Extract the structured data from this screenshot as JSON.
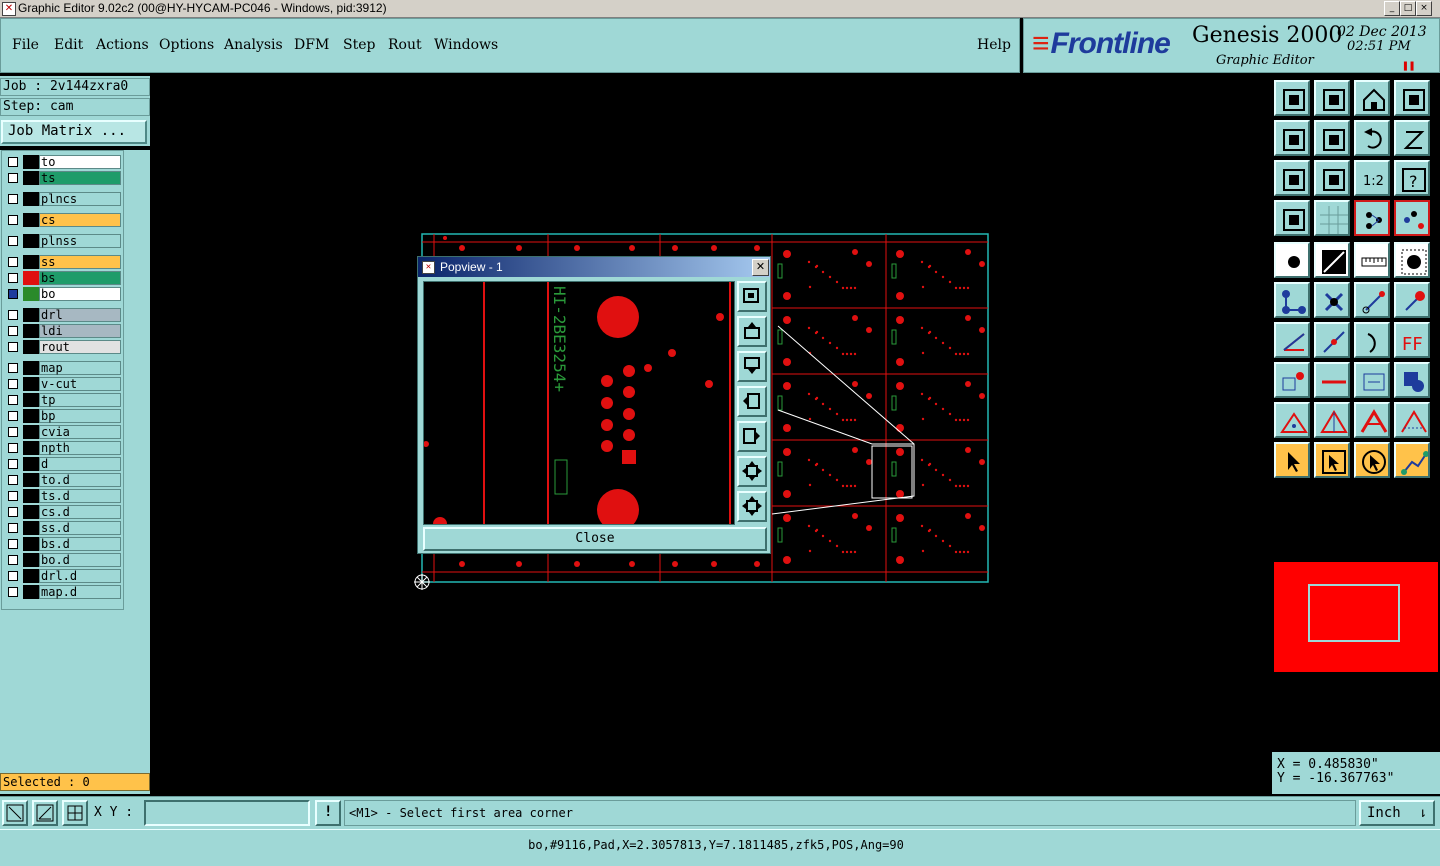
{
  "window": {
    "title": "Graphic Editor 9.02c2 (00@HY-HYCAM-PC046 - Windows, pid:3912)",
    "controls": [
      "_",
      "□",
      "×"
    ]
  },
  "menu": {
    "file": "File",
    "edit": "Edit",
    "actions": "Actions",
    "options": "Options",
    "analysis": "Analysis",
    "dfm": "DFM",
    "step": "Step",
    "rout": "Rout",
    "windows": "Windows",
    "help": "Help"
  },
  "brand": {
    "logo": "Frontline",
    "product": "Genesis 2000",
    "subtitle": "Graphic Editor",
    "date": "02  Dec 2013",
    "time": "02:51  PM"
  },
  "job": {
    "job_line": "Job : 2v144zxra0",
    "step_line": "Step: cam",
    "matrix_button": "Job Matrix ..."
  },
  "layers": [
    {
      "name": "to",
      "color": "#ffffff",
      "swatch": "#000000"
    },
    {
      "name": "ts",
      "color": "#1e9c6a",
      "swatch": "#000000"
    },
    {
      "name": "plncs",
      "color": "#9fd8d6",
      "swatch": "#000000"
    },
    {
      "name": "cs",
      "color": "#ffc24a",
      "swatch": "#000000"
    },
    {
      "name": "plnss",
      "color": "#9fd8d6",
      "swatch": "#000000"
    },
    {
      "name": "ss",
      "color": "#ffc24a",
      "swatch": "#000000"
    },
    {
      "name": "bs",
      "color": "#1e9c6a",
      "swatch": "#e01010"
    },
    {
      "name": "bo",
      "color": "#ffffff",
      "swatch": "#2a8a2a"
    },
    {
      "name": "drl",
      "color": "#a7b8c2",
      "swatch": "#000000"
    },
    {
      "name": "ldi",
      "color": "#a7b8c2",
      "swatch": "#000000"
    },
    {
      "name": "rout",
      "color": "#e2e2e2",
      "swatch": "#000000"
    },
    {
      "name": "map",
      "color": "#9fd8d6",
      "swatch": "#000000"
    },
    {
      "name": "v-cut",
      "color": "#9fd8d6",
      "swatch": "#000000"
    },
    {
      "name": "tp",
      "color": "#9fd8d6",
      "swatch": "#000000"
    },
    {
      "name": "bp",
      "color": "#9fd8d6",
      "swatch": "#000000"
    },
    {
      "name": "cvia",
      "color": "#9fd8d6",
      "swatch": "#000000"
    },
    {
      "name": "npth",
      "color": "#9fd8d6",
      "swatch": "#000000"
    },
    {
      "name": "d",
      "color": "#9fd8d6",
      "swatch": "#000000"
    },
    {
      "name": "to.d",
      "color": "#9fd8d6",
      "swatch": "#000000"
    },
    {
      "name": "ts.d",
      "color": "#9fd8d6",
      "swatch": "#000000"
    },
    {
      "name": "cs.d",
      "color": "#9fd8d6",
      "swatch": "#000000"
    },
    {
      "name": "ss.d",
      "color": "#9fd8d6",
      "swatch": "#000000"
    },
    {
      "name": "bs.d",
      "color": "#9fd8d6",
      "swatch": "#000000"
    },
    {
      "name": "bo.d",
      "color": "#9fd8d6",
      "swatch": "#000000"
    },
    {
      "name": "drl.d",
      "color": "#9fd8d6",
      "swatch": "#000000"
    },
    {
      "name": "map.d",
      "color": "#9fd8d6",
      "swatch": "#000000"
    }
  ],
  "selected": "Selected : 0",
  "coords": {
    "x": "X =  0.485830\"",
    "y": "Y = -16.367763\""
  },
  "popview": {
    "title": "Popview - 1",
    "close": "Close",
    "text": "HI-2BE3254+"
  },
  "cmd": {
    "xy_label": "X Y :",
    "xy_value": "",
    "prompt": "<M1> - Select first area corner",
    "units": "Inch"
  },
  "status": "bo,#9116,Pad,X=2.3057813,Y=7.1811485,zfk5,POS,Ang=90",
  "colors": {
    "panel": "#9fd8d6",
    "highlight": "#ffc24a",
    "pad": "#e01010",
    "outline": "#23b8b4"
  }
}
